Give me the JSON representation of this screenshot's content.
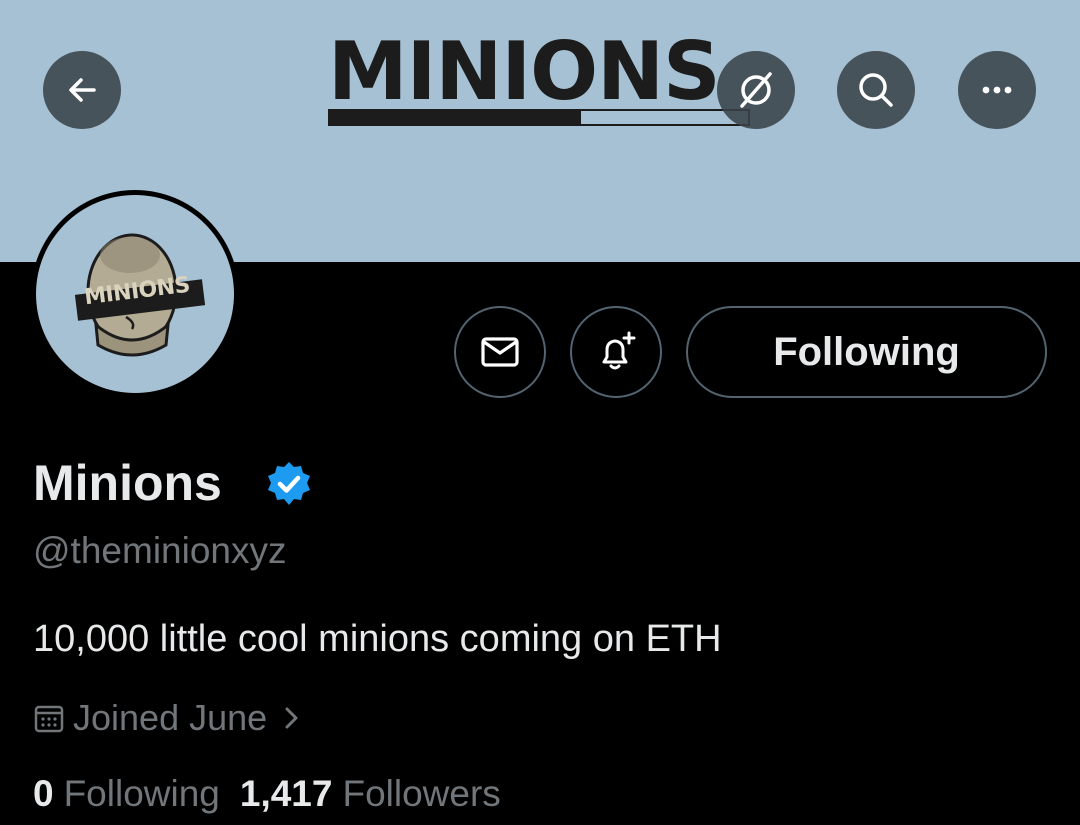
{
  "banner": {
    "logo_text": "MINIONS",
    "logo_progress": 0.6,
    "background_color": "#a6c1d4"
  },
  "header_buttons": {
    "back_icon": "arrow-left-icon",
    "grok_icon": "slash-circle-icon",
    "search_icon": "search-icon",
    "more_icon": "more-horizontal-icon"
  },
  "avatar": {
    "label": "MINIONS"
  },
  "actions": {
    "message_icon": "envelope-icon",
    "notify_icon": "bell-plus-icon",
    "follow_label": "Following"
  },
  "profile": {
    "display_name": "Minions",
    "verified_color": "#1d9bf0",
    "handle": "@theminionxyz",
    "bio": "10,000 little cool minions coming on ETH",
    "joined": "Joined June",
    "following_count": "0",
    "following_label": "Following",
    "followers_count": "1,417",
    "followers_label": "Followers"
  }
}
